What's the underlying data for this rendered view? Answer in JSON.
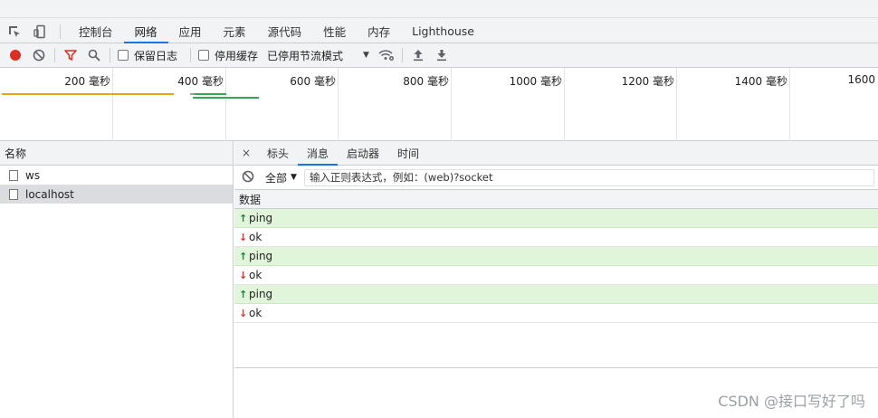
{
  "tabs": [
    {
      "label": "控制台",
      "active": false
    },
    {
      "label": "网络",
      "active": true
    },
    {
      "label": "应用",
      "active": false
    },
    {
      "label": "元素",
      "active": false
    },
    {
      "label": "源代码",
      "active": false
    },
    {
      "label": "性能",
      "active": false
    },
    {
      "label": "内存",
      "active": false
    },
    {
      "label": "Lighthouse",
      "active": false
    }
  ],
  "toolbar": {
    "preserve_log_label": "保留日志",
    "disable_cache_label": "停用缓存",
    "throttling_value": "已停用节流模式"
  },
  "overview": {
    "ticks": [
      "200 毫秒",
      "400 毫秒",
      "600 毫秒",
      "800 毫秒",
      "1000 毫秒",
      "1200 毫秒",
      "1400 毫秒",
      "1600"
    ],
    "colors": {
      "orange": "#e8a317",
      "green": "#34a853",
      "grey": "#9e9e9e"
    }
  },
  "request_list": {
    "header": "名称",
    "items": [
      {
        "name": "ws",
        "selected": false
      },
      {
        "name": "localhost",
        "selected": true
      }
    ]
  },
  "detail": {
    "close_label": "×",
    "tabs": [
      {
        "label": "标头",
        "active": false
      },
      {
        "label": "消息",
        "active": true
      },
      {
        "label": "启动器",
        "active": false
      },
      {
        "label": "时间",
        "active": false
      }
    ],
    "filter_type": "全部",
    "filter_placeholder": "输入正则表达式，例如：(web)?socket",
    "messages_header": "数据",
    "messages": [
      {
        "direction": "sent",
        "data": "ping"
      },
      {
        "direction": "received",
        "data": "ok"
      },
      {
        "direction": "sent",
        "data": "ping"
      },
      {
        "direction": "received",
        "data": "ok"
      },
      {
        "direction": "sent",
        "data": "ping"
      },
      {
        "direction": "received",
        "data": "ok"
      }
    ]
  },
  "watermark": "CSDN @接口写好了吗"
}
